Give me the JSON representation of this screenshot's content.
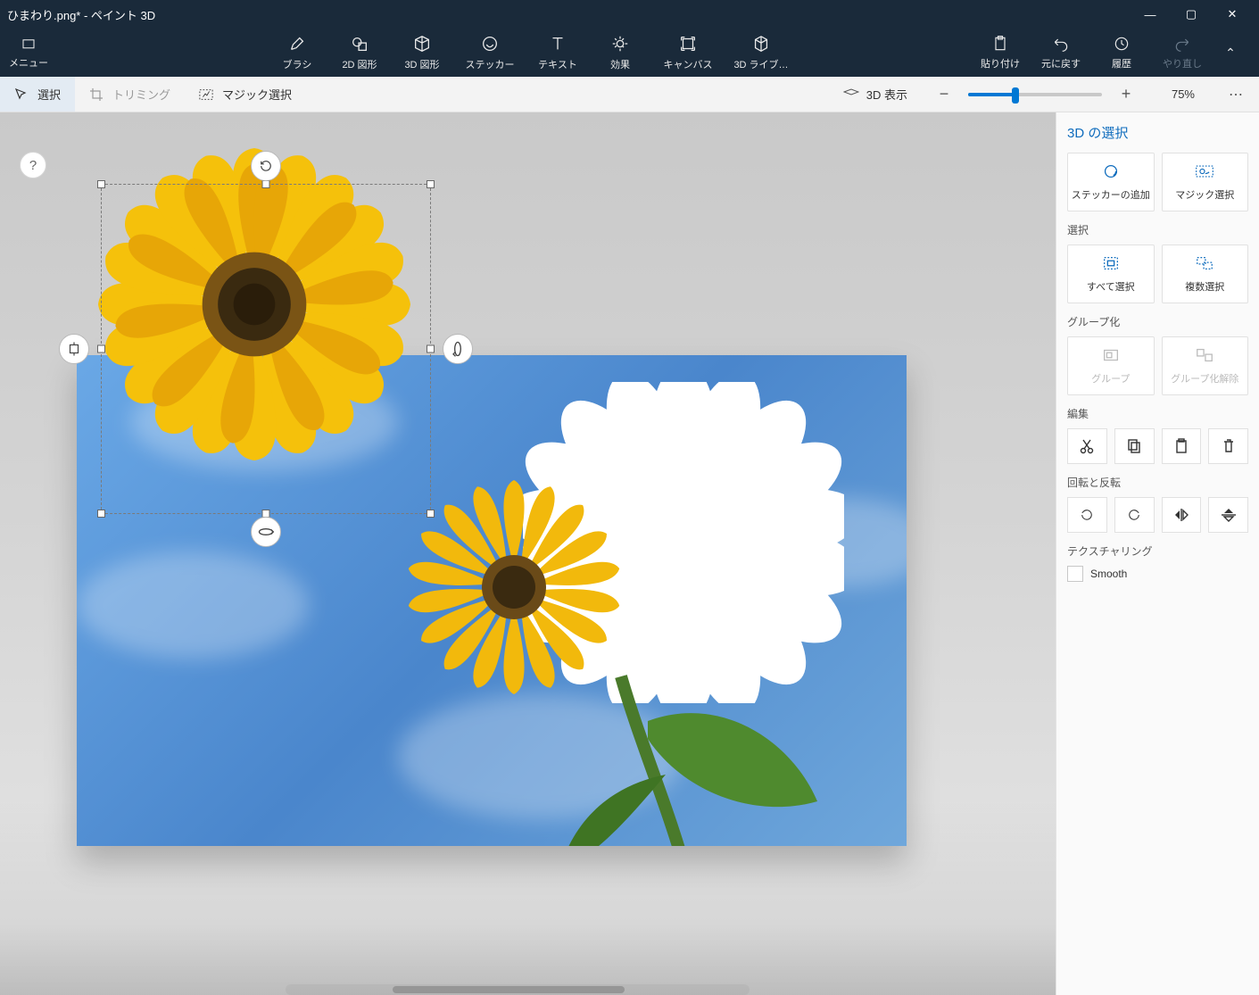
{
  "titlebar": {
    "title": "ひまわり.png* - ペイント 3D"
  },
  "ribbon": {
    "menu": "メニュー",
    "tools": {
      "brush": "ブラシ",
      "shape2d": "2D 図形",
      "shape3d": "3D 図形",
      "sticker": "ステッカー",
      "text": "テキスト",
      "effects": "効果",
      "canvas": "キャンバス",
      "lib3d": "3D ライブ…"
    },
    "right": {
      "paste": "貼り付け",
      "undo": "元に戻す",
      "history": "履歴",
      "redo": "やり直し"
    }
  },
  "subbar": {
    "select": "選択",
    "crop": "トリミング",
    "magic": "マジック選択",
    "view3d": "3D 表示",
    "zoom_pct": "75%"
  },
  "side": {
    "title": "3D の選択",
    "cards": {
      "addsticker": "ステッカーの追加",
      "magic": "マジック選択"
    },
    "section_select": "選択",
    "cards_select": {
      "selectall": "すべて選択",
      "multiselect": "複数選択"
    },
    "section_group": "グループ化",
    "cards_group": {
      "group": "グループ",
      "ungroup": "グループ化解除"
    },
    "section_edit": "編集",
    "section_rotate": "回転と反転",
    "section_texture": "テクスチャリング",
    "smooth": "Smooth"
  },
  "window": {
    "minimize": "—",
    "maximize": "▢",
    "close": "✕"
  },
  "help": "?",
  "zoom_slider_pct": 35
}
